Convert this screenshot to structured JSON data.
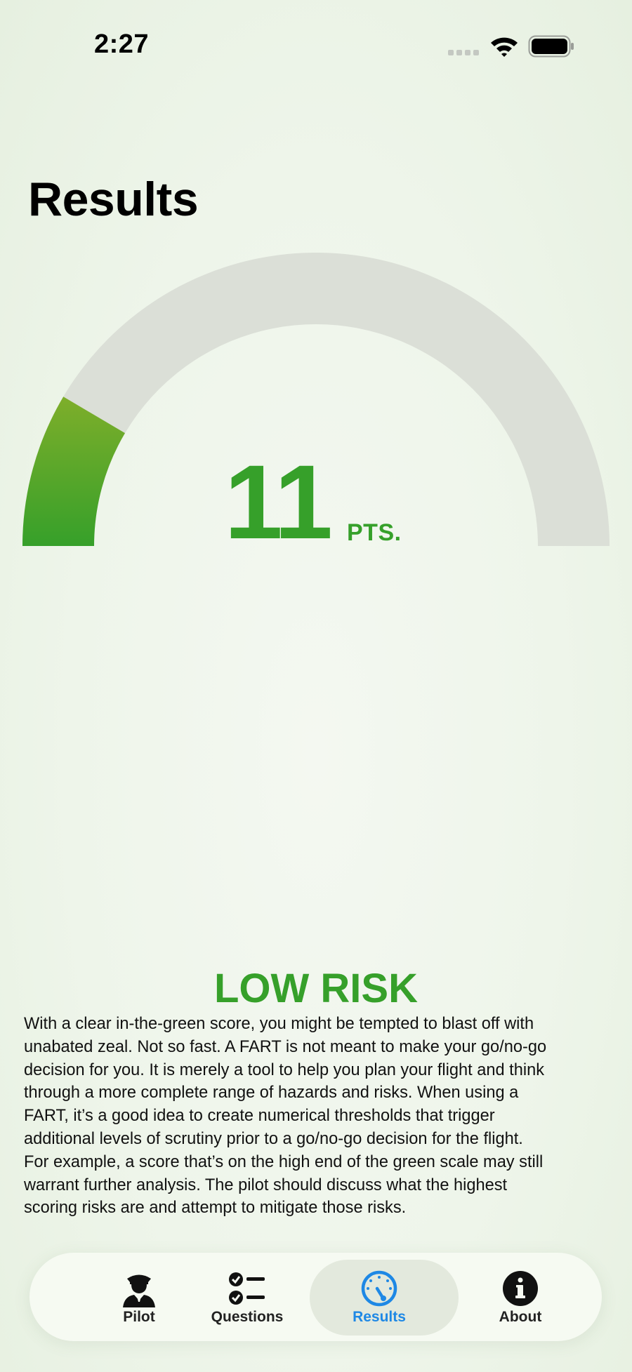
{
  "status_bar": {
    "time": "2:27"
  },
  "page": {
    "title": "Results"
  },
  "gauge": {
    "score": "11",
    "unit": "PTS.",
    "fill_fraction": 0.17,
    "colors": {
      "track": "#dbdfd7",
      "fill_start": "#7eae2a",
      "fill_end": "#36a02a"
    }
  },
  "result": {
    "level": "LOW RISK",
    "level_color": "#36a02a",
    "description_lines": [
      "With a clear in-the-green score, you might be tempted to blast off with",
      "unabated zeal. Not so fast. A FART is not meant to make your go/no-go",
      "decision for you. It is merely a tool to help you plan your flight and think",
      "through a more complete range of hazards and risks. When using a",
      "FART, it’s a good idea to create numerical thresholds that trigger",
      "additional levels of scrutiny prior to a go/no-go decision for the flight.",
      "For example, a score that’s on the high end of the green scale may still",
      "warrant further analysis. The pilot should discuss what the highest",
      "scoring risks are and attempt to mitigate those risks."
    ]
  },
  "tab_bar": {
    "accent": "#1e88e5",
    "tabs": [
      {
        "label": "Pilot",
        "icon": "pilot-icon",
        "active": false
      },
      {
        "label": "Questions",
        "icon": "checklist-icon",
        "active": false
      },
      {
        "label": "Results",
        "icon": "gauge-icon",
        "active": true
      },
      {
        "label": "About",
        "icon": "info-icon",
        "active": false
      }
    ]
  }
}
